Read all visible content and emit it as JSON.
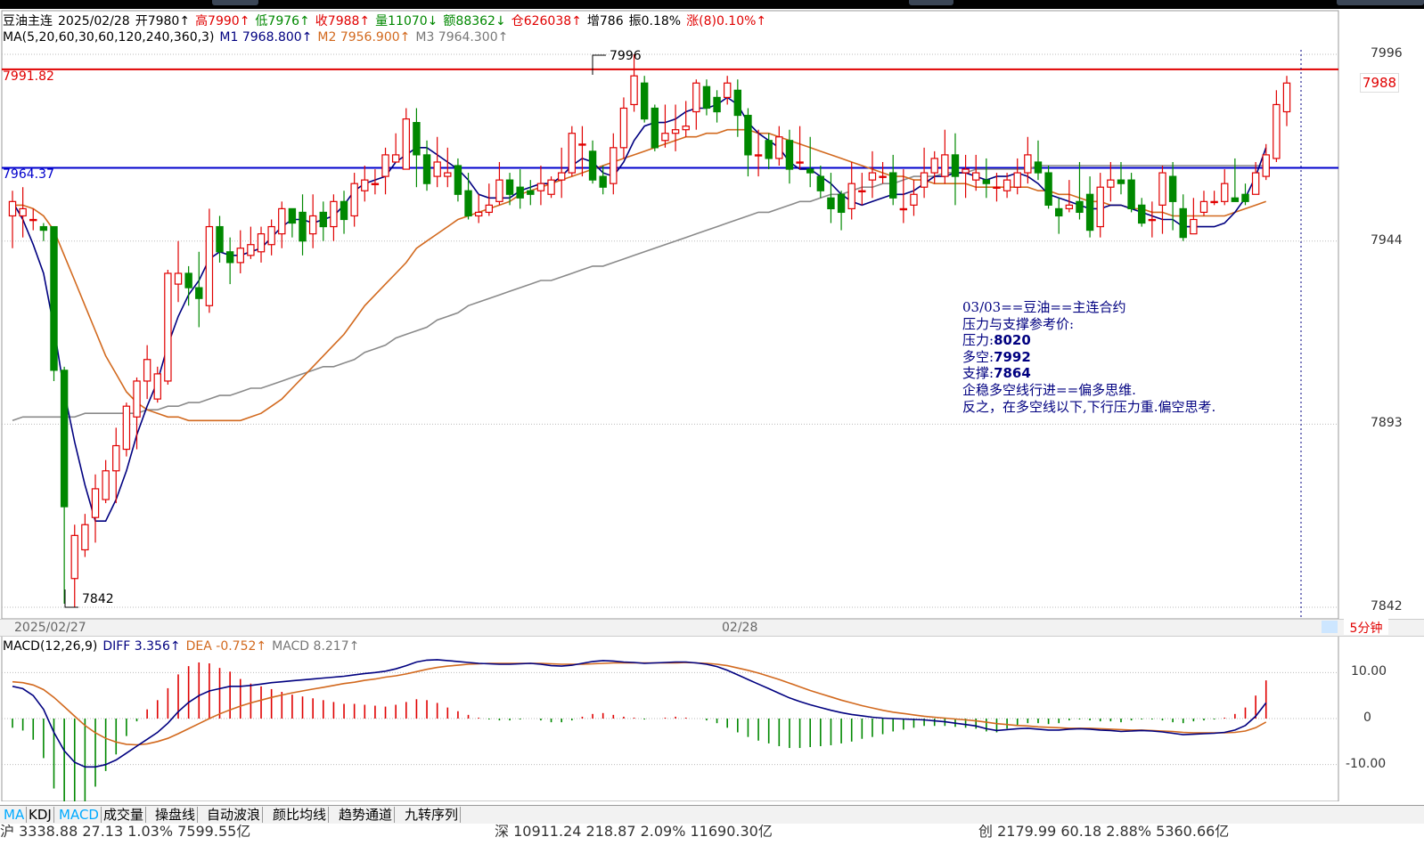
{
  "header": {
    "symbol": "豆油主连",
    "date": "2025/02/28",
    "open": "开7980↑",
    "high": "高7990↑",
    "low": "低7976↑",
    "close": "收7988↑",
    "volume": "量11070↓",
    "amount": "额88362↓",
    "oi": "仓626038↑",
    "oi_change": "增786",
    "amplitude": "振0.18%",
    "change": "涨(8)0.10%↑"
  },
  "ma_line": {
    "label": "MA(5,20,60,30,60,120,240,360,3)",
    "m1": "M1 7968.800↑",
    "m2": "M2 7956.900↑",
    "m3": "M3 7964.300↑"
  },
  "levels": {
    "resistance_label": "7991.82",
    "support_label": "7964.37"
  },
  "annotations": {
    "high_mark": "7996",
    "low_mark": "7842",
    "last_price": "7988"
  },
  "note": {
    "line1": "03/03==豆油==主连合约",
    "line2": "压力与支撑参考价:",
    "line3_label": "压力:",
    "line3_value": "8020",
    "line4_label": "多空:",
    "line4_value": "7992",
    "line5_label": "支撑:",
    "line5_value": "7864",
    "line6": "企稳多空线行进==偏多思维.",
    "line7": "反之，在多空线以下,下行压力重.偏空思考."
  },
  "date_axis": {
    "d1": "2025/02/27",
    "d2": "02/28",
    "period": "5分钟"
  },
  "macd_header": {
    "label": "MACD(12,26,9)",
    "diff": "DIFF 3.356↑",
    "dea": "DEA -0.752↑",
    "macd": "MACD 8.217↑"
  },
  "tabs": [
    "MA",
    "KDJ",
    "MACD",
    "成交量",
    "操盘线",
    "自动波浪",
    "颜比均线",
    "趋势通道",
    "九转序列"
  ],
  "bottom_strip": [
    "沪 3338.88  27.13  1.03%  7599.55亿",
    "深 10911.24  218.87  2.09%  11690.30亿",
    "创 2179.99  60.18  2.88%  5360.66亿"
  ],
  "chart_data": {
    "type": "candlestick",
    "timeframe": "5分钟",
    "price_axis": {
      "ticks": [
        7996,
        7944,
        7893,
        7842
      ],
      "ylim": [
        7842,
        7996
      ]
    },
    "macd_axis": {
      "ticks": [
        10.0,
        0,
        -10.0
      ],
      "ylim": [
        -18,
        18
      ]
    },
    "reference_lines": [
      {
        "value": 7991.82,
        "color": "#e00000"
      },
      {
        "value": 7964.37,
        "color": "#0000cc"
      }
    ],
    "candles": [
      [
        7951,
        7955,
        7958,
        7942
      ],
      [
        7951,
        7953,
        7959,
        7945
      ],
      [
        7950,
        7950,
        7953,
        7947
      ],
      [
        7948,
        7947,
        7949,
        7944
      ],
      [
        7948,
        7908,
        7948,
        7905
      ],
      [
        7908,
        7870,
        7909,
        7843
      ],
      [
        7850,
        7862,
        7865,
        7842
      ],
      [
        7858,
        7865,
        7868,
        7856
      ],
      [
        7867,
        7875,
        7879,
        7860
      ],
      [
        7872,
        7880,
        7883,
        7871
      ],
      [
        7880,
        7887,
        7892,
        7871
      ],
      [
        7886,
        7898,
        7899,
        7884
      ],
      [
        7895,
        7905,
        7906,
        7886
      ],
      [
        7905,
        7911,
        7915,
        7900
      ],
      [
        7900,
        7907,
        7909,
        7899
      ],
      [
        7905,
        7935,
        7936,
        7904
      ],
      [
        7932,
        7935,
        7944,
        7927
      ],
      [
        7935,
        7931,
        7937,
        7926
      ],
      [
        7931,
        7928,
        7941,
        7920
      ],
      [
        7926,
        7948,
        7953,
        7924
      ],
      [
        7948,
        7941,
        7951,
        7938
      ],
      [
        7941,
        7938,
        7945,
        7932
      ],
      [
        7938,
        7942,
        7947,
        7935
      ],
      [
        7940,
        7943,
        7948,
        7939
      ],
      [
        7941,
        7946,
        7948,
        7938
      ],
      [
        7943,
        7948,
        7950,
        7940
      ],
      [
        7946,
        7953,
        7955,
        7942
      ],
      [
        7953,
        7949,
        7953,
        7945
      ],
      [
        7952,
        7944,
        7957,
        7940
      ],
      [
        7946,
        7951,
        7957,
        7942
      ],
      [
        7952,
        7948,
        7955,
        7944
      ],
      [
        7948,
        7955,
        7957,
        7944
      ],
      [
        7955,
        7950,
        7958,
        7946
      ],
      [
        7951,
        7960,
        7963,
        7948
      ],
      [
        7958,
        7961,
        7965,
        7955
      ],
      [
        7960,
        7960,
        7964,
        7957
      ],
      [
        7962,
        7968,
        7970,
        7957
      ],
      [
        7966,
        7968,
        7974,
        7966
      ],
      [
        7964,
        7978,
        7981,
        7964
      ],
      [
        7977,
        7968,
        7981,
        7959
      ],
      [
        7968,
        7960,
        7972,
        7958
      ],
      [
        7962,
        7966,
        7973,
        7959
      ],
      [
        7962,
        7963,
        7970,
        7959
      ],
      [
        7965,
        7957,
        7967,
        7955
      ],
      [
        7958,
        7951,
        7963,
        7950
      ],
      [
        7951,
        7952,
        7957,
        7949
      ],
      [
        7952,
        7954,
        7960,
        7951
      ],
      [
        7955,
        7961,
        7966,
        7954
      ],
      [
        7961,
        7957,
        7963,
        7954
      ],
      [
        7959,
        7956,
        7964,
        7953
      ],
      [
        7958,
        7957,
        7961,
        7954
      ],
      [
        7958,
        7960,
        7965,
        7954
      ],
      [
        7957,
        7961,
        7962,
        7956
      ],
      [
        7961,
        7963,
        7970,
        7956
      ],
      [
        7963,
        7974,
        7976,
        7962
      ],
      [
        7971,
        7971,
        7976,
        7962
      ],
      [
        7969,
        7961,
        7972,
        7960
      ],
      [
        7962,
        7959,
        7965,
        7957
      ],
      [
        7960,
        7970,
        7974,
        7957
      ],
      [
        7970,
        7981,
        7984,
        7967
      ],
      [
        7982,
        7990,
        7996,
        7980
      ],
      [
        7988,
        7978,
        7990,
        7977
      ],
      [
        7981,
        7970,
        7982,
        7969
      ],
      [
        7972,
        7974,
        7982,
        7970
      ],
      [
        7974,
        7975,
        7982,
        7969
      ],
      [
        7975,
        7976,
        7983,
        7973
      ],
      [
        7980,
        7988,
        7989,
        7975
      ],
      [
        7987,
        7981,
        7989,
        7979
      ],
      [
        7984,
        7980,
        7986,
        7977
      ],
      [
        7984,
        7988,
        7990,
        7982
      ],
      [
        7986,
        7979,
        7989,
        7973
      ],
      [
        7979,
        7968,
        7981,
        7962
      ],
      [
        7968,
        7968,
        7975,
        7962
      ],
      [
        7972,
        7967,
        7974,
        7964
      ],
      [
        7967,
        7973,
        7976,
        7965
      ],
      [
        7972,
        7964,
        7975,
        7960
      ],
      [
        7966,
        7966,
        7976,
        7964
      ],
      [
        7964,
        7963,
        7973,
        7959
      ],
      [
        7962,
        7958,
        7965,
        7956
      ],
      [
        7956,
        7953,
        7963,
        7949
      ],
      [
        7957,
        7952,
        7958,
        7947
      ],
      [
        7953,
        7960,
        7966,
        7950
      ],
      [
        7958,
        7958,
        7963,
        7954
      ],
      [
        7961,
        7963,
        7969,
        7956
      ],
      [
        7962,
        7962,
        7966,
        7960
      ],
      [
        7963,
        7956,
        7968,
        7954
      ],
      [
        7953,
        7953,
        7964,
        7949
      ],
      [
        7954,
        7957,
        7961,
        7951
      ],
      [
        7959,
        7963,
        7970,
        7956
      ],
      [
        7963,
        7967,
        7969,
        7960
      ],
      [
        7962,
        7968,
        7975,
        7960
      ],
      [
        7968,
        7962,
        7974,
        7954
      ],
      [
        7963,
        7964,
        7968,
        7956
      ],
      [
        7961,
        7963,
        7968,
        7958
      ],
      [
        7961,
        7960,
        7967,
        7956
      ],
      [
        7959,
        7959,
        7963,
        7955
      ],
      [
        7958,
        7961,
        7963,
        7956
      ],
      [
        7959,
        7963,
        7967,
        7957
      ],
      [
        7963,
        7968,
        7973,
        7960
      ],
      [
        7966,
        7963,
        7972,
        7961
      ],
      [
        7963,
        7954,
        7965,
        7953
      ],
      [
        7953,
        7951,
        7956,
        7946
      ],
      [
        7953,
        7954,
        7961,
        7952
      ],
      [
        7955,
        7952,
        7966,
        7950
      ],
      [
        7957,
        7947,
        7962,
        7945
      ],
      [
        7948,
        7959,
        7963,
        7945
      ],
      [
        7959,
        7961,
        7966,
        7955
      ],
      [
        7961,
        7960,
        7966,
        7957
      ],
      [
        7961,
        7953,
        7963,
        7952
      ],
      [
        7954,
        7949,
        7956,
        7948
      ],
      [
        7950,
        7950,
        7955,
        7945
      ],
      [
        7954,
        7963,
        7965,
        7946
      ],
      [
        7962,
        7955,
        7966,
        7947
      ],
      [
        7953,
        7945,
        7957,
        7944
      ],
      [
        7946,
        7950,
        7956,
        7946
      ],
      [
        7952,
        7955,
        7958,
        7951
      ],
      [
        7955,
        7955,
        7958,
        7954
      ],
      [
        7955,
        7960,
        7964,
        7954
      ],
      [
        7956,
        7955,
        7967,
        7955
      ],
      [
        7957,
        7955,
        7960,
        7954
      ],
      [
        7957,
        7963,
        7966,
        7957
      ],
      [
        7962,
        7968,
        7971,
        7961
      ],
      [
        7967,
        7982,
        7986,
        7966
      ],
      [
        7980,
        7988,
        7990,
        7976
      ]
    ],
    "ma_fast": [
      7955,
      7950,
      7943,
      7935,
      7920,
      7902,
      7888,
      7876,
      7866,
      7866,
      7872,
      7880,
      7890,
      7898,
      7905,
      7915,
      7923,
      7929,
      7933,
      7939,
      7941,
      7940,
      7940,
      7941,
      7942,
      7945,
      7948,
      7950,
      7950,
      7949,
      7950,
      7951,
      7954,
      7958,
      7960,
      7961,
      7962,
      7966,
      7968,
      7970,
      7970,
      7968,
      7966,
      7964,
      7961,
      7957,
      7956,
      7956,
      7956,
      7958,
      7959,
      7960,
      7960,
      7962,
      7965,
      7967,
      7966,
      7963,
      7962,
      7966,
      7972,
      7976,
      7977,
      7977,
      7978,
      7980,
      7981,
      7981,
      7982,
      7984,
      7982,
      7977,
      7974,
      7972,
      7970,
      7966,
      7964,
      7964,
      7962,
      7960,
      7957,
      7955,
      7954,
      7955,
      7956,
      7957,
      7957,
      7958,
      7960,
      7962,
      7962,
      7963,
      7963,
      7962,
      7961,
      7962,
      7962,
      7963,
      7962,
      7960,
      7957,
      7956,
      7955,
      7954,
      7953,
      7953,
      7954,
      7954,
      7953,
      7952,
      7951,
      7950,
      7950,
      7948,
      7948,
      7948,
      7948,
      7949,
      7952,
      7956,
      7962,
      7970
    ],
    "ma_mid": [
      7954,
      7954,
      7953,
      7951,
      7947,
      7940,
      7933,
      7926,
      7919,
      7912,
      7907,
      7902,
      7899,
      7897,
      7896,
      7895,
      7895,
      7894,
      7894,
      7894,
      7894,
      7894,
      7894,
      7895,
      7896,
      7898,
      7900,
      7903,
      7906,
      7909,
      7912,
      7915,
      7918,
      7922,
      7926,
      7929,
      7932,
      7935,
      7938,
      7942,
      7944,
      7946,
      7948,
      7950,
      7951,
      7952,
      7953,
      7954,
      7955,
      7957,
      7958,
      7959,
      7960,
      7961,
      7962,
      7963,
      7964,
      7965,
      7966,
      7967,
      7968,
      7969,
      7970,
      7971,
      7972,
      7973,
      7973,
      7974,
      7974,
      7975,
      7975,
      7975,
      7974,
      7974,
      7973,
      7972,
      7971,
      7970,
      7969,
      7968,
      7967,
      7966,
      7965,
      7964,
      7963,
      7962,
      7962,
      7961,
      7961,
      7960,
      7960,
      7960,
      7960,
      7959,
      7959,
      7959,
      7959,
      7959,
      7959,
      7958,
      7958,
      7957,
      7957,
      7956,
      7955,
      7955,
      7954,
      7954,
      7953,
      7953,
      7952,
      7952,
      7951,
      7951,
      7951,
      7951,
      7951,
      7951,
      7952,
      7953,
      7954,
      7955
    ],
    "ma_slow": [
      7894,
      7895,
      7895,
      7895,
      7895,
      7895,
      7895,
      7896,
      7896,
      7896,
      7896,
      7896,
      7896,
      7897,
      7897,
      7898,
      7898,
      7899,
      7899,
      7900,
      7901,
      7901,
      7902,
      7903,
      7903,
      7904,
      7905,
      7906,
      7907,
      7908,
      7909,
      7909,
      7910,
      7911,
      7913,
      7914,
      7915,
      7917,
      7918,
      7919,
      7920,
      7922,
      7923,
      7924,
      7926,
      7927,
      7928,
      7929,
      7930,
      7931,
      7932,
      7933,
      7933,
      7934,
      7935,
      7936,
      7937,
      7937,
      7938,
      7939,
      7940,
      7941,
      7942,
      7943,
      7944,
      7945,
      7946,
      7947,
      7948,
      7949,
      7950,
      7951,
      7952,
      7952,
      7953,
      7954,
      7955,
      7955,
      7956,
      7957,
      7957,
      7958,
      7959,
      7959,
      7960,
      7960,
      7961,
      7962,
      7962,
      7962,
      7963,
      7963,
      7963,
      7964,
      7964,
      7964,
      7964,
      7964,
      7964,
      7965,
      7965,
      7965,
      7965,
      7965,
      7965,
      7965,
      7965,
      7965,
      7965,
      7965,
      7965,
      7965,
      7965,
      7965,
      7965,
      7965,
      7965,
      7965,
      7965,
      7965,
      7965,
      7965
    ],
    "macd_diff": [
      7.0,
      6.5,
      5.0,
      2.0,
      -3.0,
      -7.0,
      -9.5,
      -10.5,
      -10.5,
      -10.0,
      -9.0,
      -7.5,
      -6.0,
      -4.5,
      -3.0,
      -1.0,
      1.5,
      3.5,
      5.0,
      6.0,
      6.5,
      7.0,
      7.0,
      7.2,
      7.5,
      7.8,
      8.0,
      8.2,
      8.4,
      8.6,
      8.8,
      9.0,
      9.2,
      9.5,
      9.8,
      10.0,
      10.3,
      10.8,
      11.5,
      12.3,
      12.7,
      12.8,
      12.6,
      12.4,
      12.2,
      12.0,
      11.9,
      11.8,
      11.8,
      11.9,
      12.0,
      11.8,
      11.5,
      11.4,
      11.6,
      12.0,
      12.4,
      12.6,
      12.5,
      12.3,
      12.2,
      12.0,
      12.1,
      12.2,
      12.3,
      12.3,
      12.1,
      11.8,
      11.3,
      10.5,
      9.5,
      8.5,
      7.5,
      6.5,
      5.5,
      4.5,
      3.7,
      3.0,
      2.4,
      1.8,
      1.3,
      0.9,
      0.6,
      0.3,
      0.1,
      0.0,
      -0.1,
      -0.2,
      -0.3,
      -0.5,
      -0.7,
      -1.0,
      -1.3,
      -1.6,
      -2.2,
      -2.6,
      -2.4,
      -2.2,
      -2.1,
      -2.3,
      -2.5,
      -2.5,
      -2.3,
      -2.2,
      -2.3,
      -2.5,
      -2.6,
      -2.8,
      -2.7,
      -2.6,
      -2.7,
      -2.9,
      -3.2,
      -3.5,
      -3.4,
      -3.3,
      -3.2,
      -3.0,
      -2.5,
      -1.5,
      0.5,
      3.4
    ],
    "macd_dea": [
      8.0,
      7.8,
      7.3,
      6.3,
      4.6,
      2.6,
      0.5,
      -1.5,
      -3.1,
      -4.3,
      -5.1,
      -5.6,
      -5.7,
      -5.5,
      -5.0,
      -4.3,
      -3.3,
      -2.2,
      -1.1,
      0.0,
      1.0,
      1.9,
      2.7,
      3.4,
      4.0,
      4.6,
      5.1,
      5.6,
      6.0,
      6.4,
      6.8,
      7.2,
      7.6,
      7.9,
      8.3,
      8.6,
      9.0,
      9.3,
      9.7,
      10.2,
      10.7,
      11.1,
      11.4,
      11.6,
      11.8,
      11.9,
      12.0,
      12.0,
      12.0,
      12.0,
      12.0,
      12.0,
      11.9,
      11.8,
      11.8,
      11.8,
      11.9,
      12.0,
      12.1,
      12.1,
      12.1,
      12.1,
      12.1,
      12.1,
      12.1,
      12.2,
      12.1,
      12.0,
      11.8,
      11.5,
      11.0,
      10.5,
      9.9,
      9.2,
      8.5,
      7.7,
      6.9,
      6.1,
      5.4,
      4.7,
      4.0,
      3.4,
      2.8,
      2.3,
      1.8,
      1.4,
      1.1,
      0.8,
      0.5,
      0.3,
      0.1,
      -0.1,
      -0.3,
      -0.5,
      -0.8,
      -1.1,
      -1.3,
      -1.5,
      -1.6,
      -1.8,
      -1.9,
      -2.0,
      -2.1,
      -2.1,
      -2.1,
      -2.2,
      -2.3,
      -2.4,
      -2.5,
      -2.5,
      -2.6,
      -2.7,
      -2.8,
      -3.0,
      -3.1,
      -3.1,
      -3.1,
      -3.1,
      -3.0,
      -2.7,
      -2.0,
      -0.75
    ]
  }
}
